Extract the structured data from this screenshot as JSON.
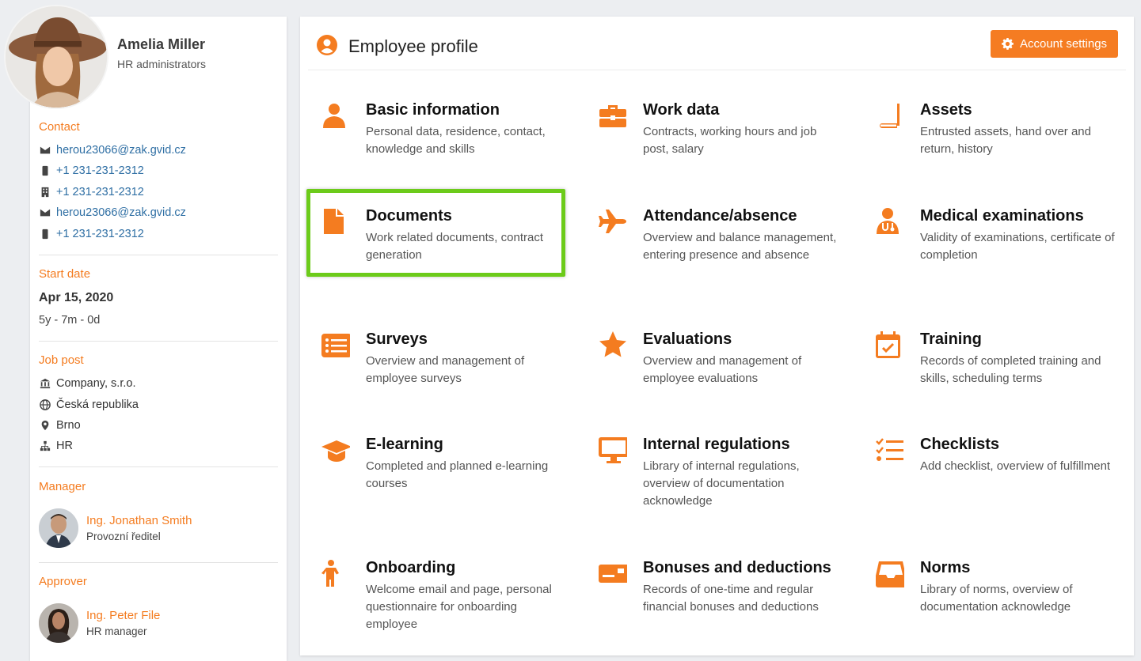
{
  "user": {
    "name": "Amelia Miller",
    "role": "HR administrators"
  },
  "contact": {
    "title": "Contact",
    "items": [
      {
        "icon": "envelope-icon",
        "value": "herou23066@zak.gvid.cz"
      },
      {
        "icon": "mobile-icon",
        "value": "+1 231-231-2312"
      },
      {
        "icon": "building-icon",
        "value": "+1 231-231-2312"
      },
      {
        "icon": "envelope-icon",
        "value": "herou23066@zak.gvid.cz"
      },
      {
        "icon": "mobile-icon",
        "value": "+1 231-231-2312"
      }
    ]
  },
  "start": {
    "title": "Start date",
    "date": "Apr 15, 2020",
    "duration": "5y - 7m - 0d"
  },
  "job": {
    "title": "Job post",
    "items": [
      {
        "icon": "bank-icon",
        "value": "Company, s.r.o."
      },
      {
        "icon": "globe-icon",
        "value": "Česká republika"
      },
      {
        "icon": "map-pin-icon",
        "value": "Brno"
      },
      {
        "icon": "sitemap-icon",
        "value": "HR"
      }
    ]
  },
  "manager": {
    "title": "Manager",
    "name": "Ing. Jonathan Smith",
    "role": "Provozní ředitel"
  },
  "approver": {
    "title": "Approver",
    "name": "Ing. Peter File",
    "role": "HR manager"
  },
  "main": {
    "title": "Employee profile",
    "account_button": "Account settings",
    "accent": "#f47c20",
    "highlight_color": "#6ccb1a",
    "tiles": [
      {
        "icon": "user-icon",
        "title": "Basic information",
        "desc": "Personal data, residence, contact, knowledge and skills"
      },
      {
        "icon": "briefcase-icon",
        "title": "Work data",
        "desc": "Contracts, working hours and job post, salary"
      },
      {
        "icon": "book-icon",
        "title": "Assets",
        "desc": "Entrusted assets, hand over and return, history"
      },
      {
        "icon": "file-icon",
        "title": "Documents",
        "desc": "Work related documents, contract generation"
      },
      {
        "icon": "plane-icon",
        "title": "Attendance/absence",
        "desc": "Overview and balance management, entering presence and absence"
      },
      {
        "icon": "doctor-icon",
        "title": "Medical examinations",
        "desc": "Validity of examinations, certificate of completion"
      },
      {
        "icon": "list-icon",
        "title": "Surveys",
        "desc": "Overview and management of employee surveys"
      },
      {
        "icon": "star-icon",
        "title": "Evaluations",
        "desc": "Overview and management of employee evaluations"
      },
      {
        "icon": "calendar-check-icon",
        "title": "Training",
        "desc": "Records of completed training and skills, scheduling terms"
      },
      {
        "icon": "graduation-cap-icon",
        "title": "E-learning",
        "desc": "Completed and planned e-learning courses"
      },
      {
        "icon": "monitor-icon",
        "title": "Internal regulations",
        "desc": "Library of internal regulations, overview of documentation acknowledge"
      },
      {
        "icon": "checklist-icon",
        "title": "Checklists",
        "desc": "Add checklist, overview of fulfillment"
      },
      {
        "icon": "child-icon",
        "title": "Onboarding",
        "desc": "Welcome email and page, personal questionnaire for onboarding employee"
      },
      {
        "icon": "money-card-icon",
        "title": "Bonuses and deductions",
        "desc": "Records of one-time and regular financial bonuses and deductions"
      },
      {
        "icon": "inbox-icon",
        "title": "Norms",
        "desc": "Library of norms, overview of documentation acknowledge"
      }
    ]
  }
}
